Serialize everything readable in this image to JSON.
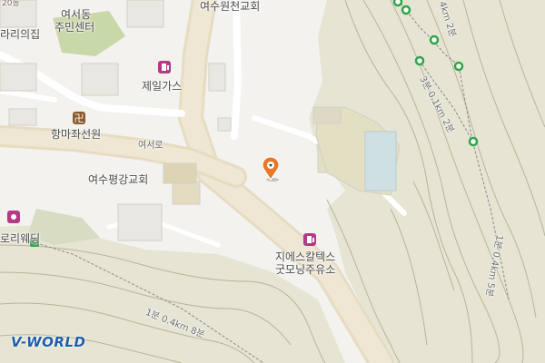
{
  "labels": {
    "yeoseo_dong": "여서동",
    "community_center": "주민센터",
    "yeosu_won_church": "여수원천교회",
    "jeil_gas": "제일가스",
    "hangmajwa_temple": "항마좌선원",
    "yeoseo_ro": "여서로",
    "yeosu_pyeonggang_church": "여수평강교회",
    "gs_caltex": "지에스칼텍스",
    "good_morning_station": "굿모닝주유소",
    "rari_house": "라리의집",
    "lorie_wedding": "로리웨딩",
    "top_edge_number": "20동",
    "trail_left": "1분 0.4km 8분",
    "trail_right_top": "3분 0.1km 2분",
    "trail_right_mid": "4km 2분",
    "trail_right_bottom": "1분 0.4km 5분"
  },
  "logo": "V-WORLD",
  "colors": {
    "background": "#f3f2ee",
    "terrain": "#e6e4d3",
    "road": "#ebe3cf",
    "park": "#c9d8a8",
    "trail_node": "#2fa54a",
    "marker": "#e8782a",
    "poi_pink": "#b23a86",
    "temple_brown": "#8a5a2b"
  },
  "icons": {
    "gas_station": "gas-pump-icon",
    "temple": "manji-icon",
    "location_marker": "map-pin-icon",
    "trail_node": "green-circle-icon",
    "wedding": "wedding-icon"
  }
}
